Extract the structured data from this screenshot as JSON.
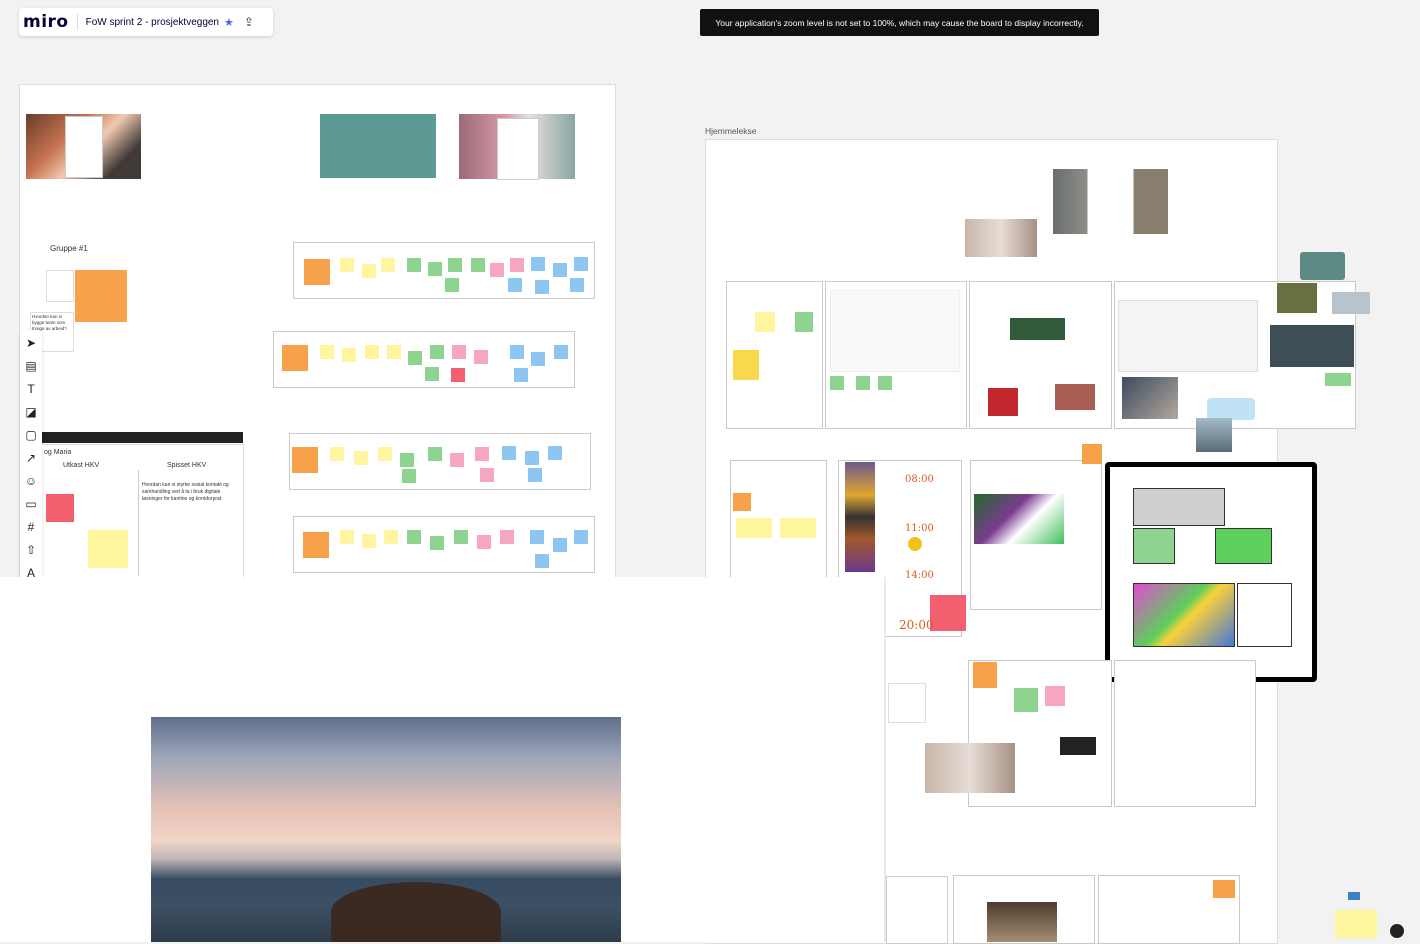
{
  "app": {
    "logo": "miro",
    "board_title": "FoW sprint 2 - prosjektveggen",
    "star": "★",
    "share_icon": "⇪"
  },
  "banner": {
    "text": "Your application's zoom level is not set to 100%, which may cause the board to display incorrectly."
  },
  "canvas": {
    "group_label": "Gruppe #1",
    "frame_label_homework": "Hjemmelekse",
    "kanban": {
      "header_partial": "og Maria",
      "col1": "Utkast HKV",
      "col2": "Spisset HKV",
      "col2_text": "Hvordan kan vi styrke sosial kontakt og samhandling ved å ta i bruk digitale løsninger for kantine og korridorprat",
      "side_note": "Hvordan kan vi bygge team som trygge av arbeid?"
    },
    "clock_times": [
      "08:00",
      "11:00",
      "14:00",
      "20:00"
    ]
  },
  "toolbar": {
    "tools": [
      {
        "name": "select-tool",
        "glyph": "➤"
      },
      {
        "name": "templates-tool",
        "glyph": "▤"
      },
      {
        "name": "text-tool",
        "glyph": "T"
      },
      {
        "name": "sticky-note-tool",
        "glyph": "◪"
      },
      {
        "name": "shape-tool",
        "glyph": "▢"
      },
      {
        "name": "connector-tool",
        "glyph": "↗"
      },
      {
        "name": "emoji-tool",
        "glyph": "☺"
      },
      {
        "name": "comment-tool",
        "glyph": "▭"
      },
      {
        "name": "frame-tool",
        "glyph": "#"
      },
      {
        "name": "upload-tool",
        "glyph": "⇧"
      },
      {
        "name": "more-tool",
        "glyph": "A"
      }
    ]
  },
  "colors": {
    "brand": "#050038",
    "accent": "#4262ff",
    "sticky_orange": "#f8a14b",
    "sticky_yellow": "#fff59e",
    "sticky_green": "#8ed38f",
    "sticky_pink": "#f6a6c3",
    "sticky_blue": "#8ec6f2",
    "sticky_red": "#f25f6e"
  }
}
